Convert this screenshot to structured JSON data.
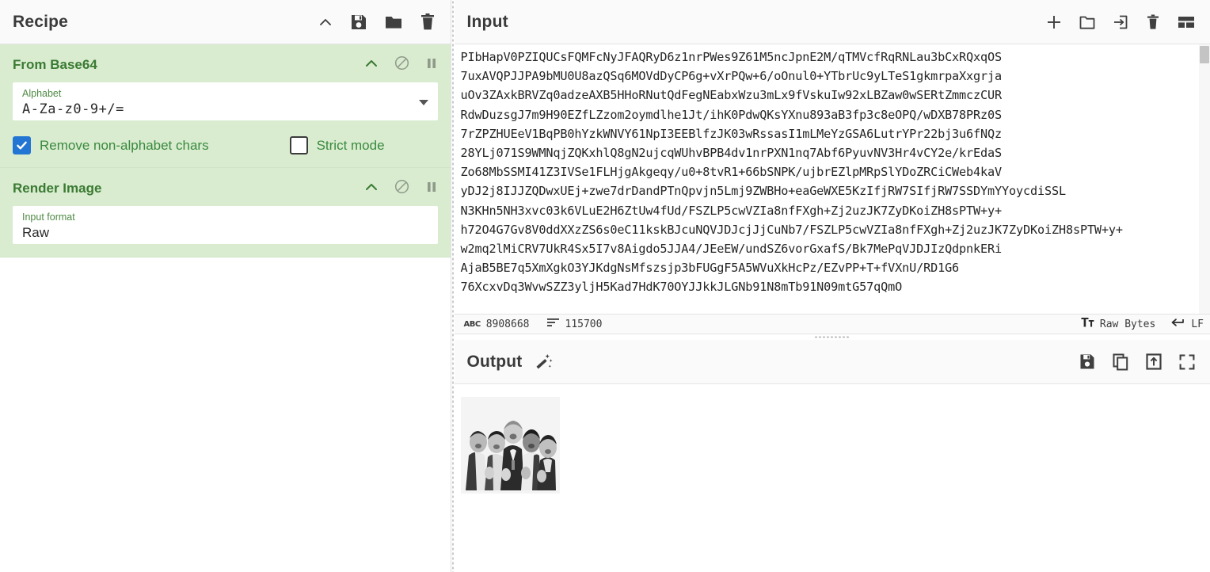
{
  "recipe": {
    "title": "Recipe",
    "header_icons": [
      {
        "name": "collapse-chevron-icon",
        "glyph": "chevron-up"
      },
      {
        "name": "save-recipe-icon",
        "glyph": "floppy"
      },
      {
        "name": "load-recipe-icon",
        "glyph": "folder"
      },
      {
        "name": "clear-recipe-icon",
        "glyph": "trash"
      }
    ],
    "operations": [
      {
        "title": "From Base64",
        "controls": [
          {
            "name": "op-collapse-icon",
            "glyph": "chevron-up"
          },
          {
            "name": "disable-operation-icon",
            "glyph": "circle-slash"
          },
          {
            "name": "pause-breakpoint-icon",
            "glyph": "pause"
          }
        ],
        "args": [
          {
            "label": "Alphabet",
            "value": "A-Za-z0-9+/=",
            "type": "select",
            "mono": true
          }
        ],
        "checkboxes": [
          {
            "label": "Remove non-alphabet chars",
            "checked": true
          },
          {
            "label": "Strict mode",
            "checked": false
          }
        ]
      },
      {
        "title": "Render Image",
        "controls": [
          {
            "name": "op-collapse-icon",
            "glyph": "chevron-up"
          },
          {
            "name": "disable-operation-icon",
            "glyph": "circle-slash"
          },
          {
            "name": "pause-breakpoint-icon",
            "glyph": "pause"
          }
        ],
        "args": [
          {
            "label": "Input format",
            "value": "Raw",
            "type": "select",
            "mono": false
          }
        ],
        "checkboxes": []
      }
    ]
  },
  "input": {
    "title": "Input",
    "header_icons": [
      {
        "name": "add-input-tab-icon",
        "glyph": "plus"
      },
      {
        "name": "open-folder-icon",
        "glyph": "folder-outline"
      },
      {
        "name": "open-file-as-input-icon",
        "glyph": "import"
      },
      {
        "name": "clear-input-icon",
        "glyph": "trash"
      },
      {
        "name": "tab-layout-icon",
        "glyph": "layout"
      }
    ],
    "content": "PIbHapV0PZIQUCsFQMFcNyJFAQRyD6z1nrPWes9Z61M5ncJpnE2M/qTMVcfRqRNLau3bCxRQxqOS\n7uxAVQPJJPA9bMU0U8azQSq6MOVdDyCP6g+vXrPQw+6/oOnul0+YTbrUc9yLTeS1gkmrpaXxgrja\nuOv3ZAxkBRVZq0adzeAXB5HHoRNutQdFegNEabxWzu3mLx9fVskuIw92xLBZaw0wSERtZmmczCUR\nRdwDuzsgJ7m9H90EZfLZzom2oymdlhe1Jt/ihK0PdwQKsYXnu893aB3fp3c8eOPQ/wDXB78PRz0S\n7rZPZHUEeV1BqPB0hYzkWNVY61NpI3EEBlfzJK03wRssasI1mLMeYzGSA6LutrYPr22bj3u6fNQz\n28YLj071S9WMNqjZQKxhlQ8gN2ujcqWUhvBPB4dv1nrPXN1nq7Abf6PyuvNV3Hr4vCY2e/krEdaS\nZo68MbSSMI41Z3IVSe1FLHjgAkgeqy/u0+8tvR1+66bSNPK/ujbrEZlpMRpSlYDoZRCiCWeb4kaV\nyDJ2j8IJJZQDwxUEj+zwe7drDandPTnQpvjn5Lmj9ZWBHo+eaGeWXE5KzIfjRW7SIfjRW7SSDYmYYoycdiSSL\nN3KHn5NH3xvc03k6VLuE2H6ZtUw4fUd/FSZLP5cwVZIa8nfFXgh+Zj2uzJK7ZyDKoiZH8sPTW+y+\nh72O4G7Gv8V0ddXXzZS6s0eC11kskBJcuNQVJDJcjJjCuNb7/FSZLP5cwVZIa8nfFXgh+Zj2uzJK7ZyDKoiZH8sPTW+y+\nw2mq2lMiCRV7UkR4Sx5I7v8Aigdo5JJA4/JEeEW/undSZ6vorGxafS/Bk7MePqVJDJIzQdpnkERi\nAjaB5BE7q5XmXgkO3YJKdgNsMfszsjp3bFUGgF5A5WVuXkHcPz/EZvPP+T+fVXnU/RD1G6\n76XcxvDq3WvwSZZ3yljH5Kad7HdK70OYJJkkJLGNb91N8mTb91N09mtG57qQmO\n",
    "status": {
      "chars_label": "8908668",
      "lines_label": "115700",
      "encoding": "Raw Bytes",
      "line_ending": "LF"
    }
  },
  "output": {
    "title": "Output",
    "magic_icon": "magic-wand-icon",
    "header_icons": [
      {
        "name": "save-output-icon",
        "glyph": "floppy"
      },
      {
        "name": "copy-output-icon",
        "glyph": "copy"
      },
      {
        "name": "replace-input-icon",
        "glyph": "open-in"
      },
      {
        "name": "maximise-output-icon",
        "glyph": "fullscreen"
      }
    ],
    "rendered_image_alt": "Rendered grayscale photograph of five people in business attire"
  },
  "colors": {
    "op_background": "#d9ecd0",
    "op_title": "#3a7a32",
    "checkbox_checked": "#2275d3",
    "panel_header": "#fafafa"
  }
}
